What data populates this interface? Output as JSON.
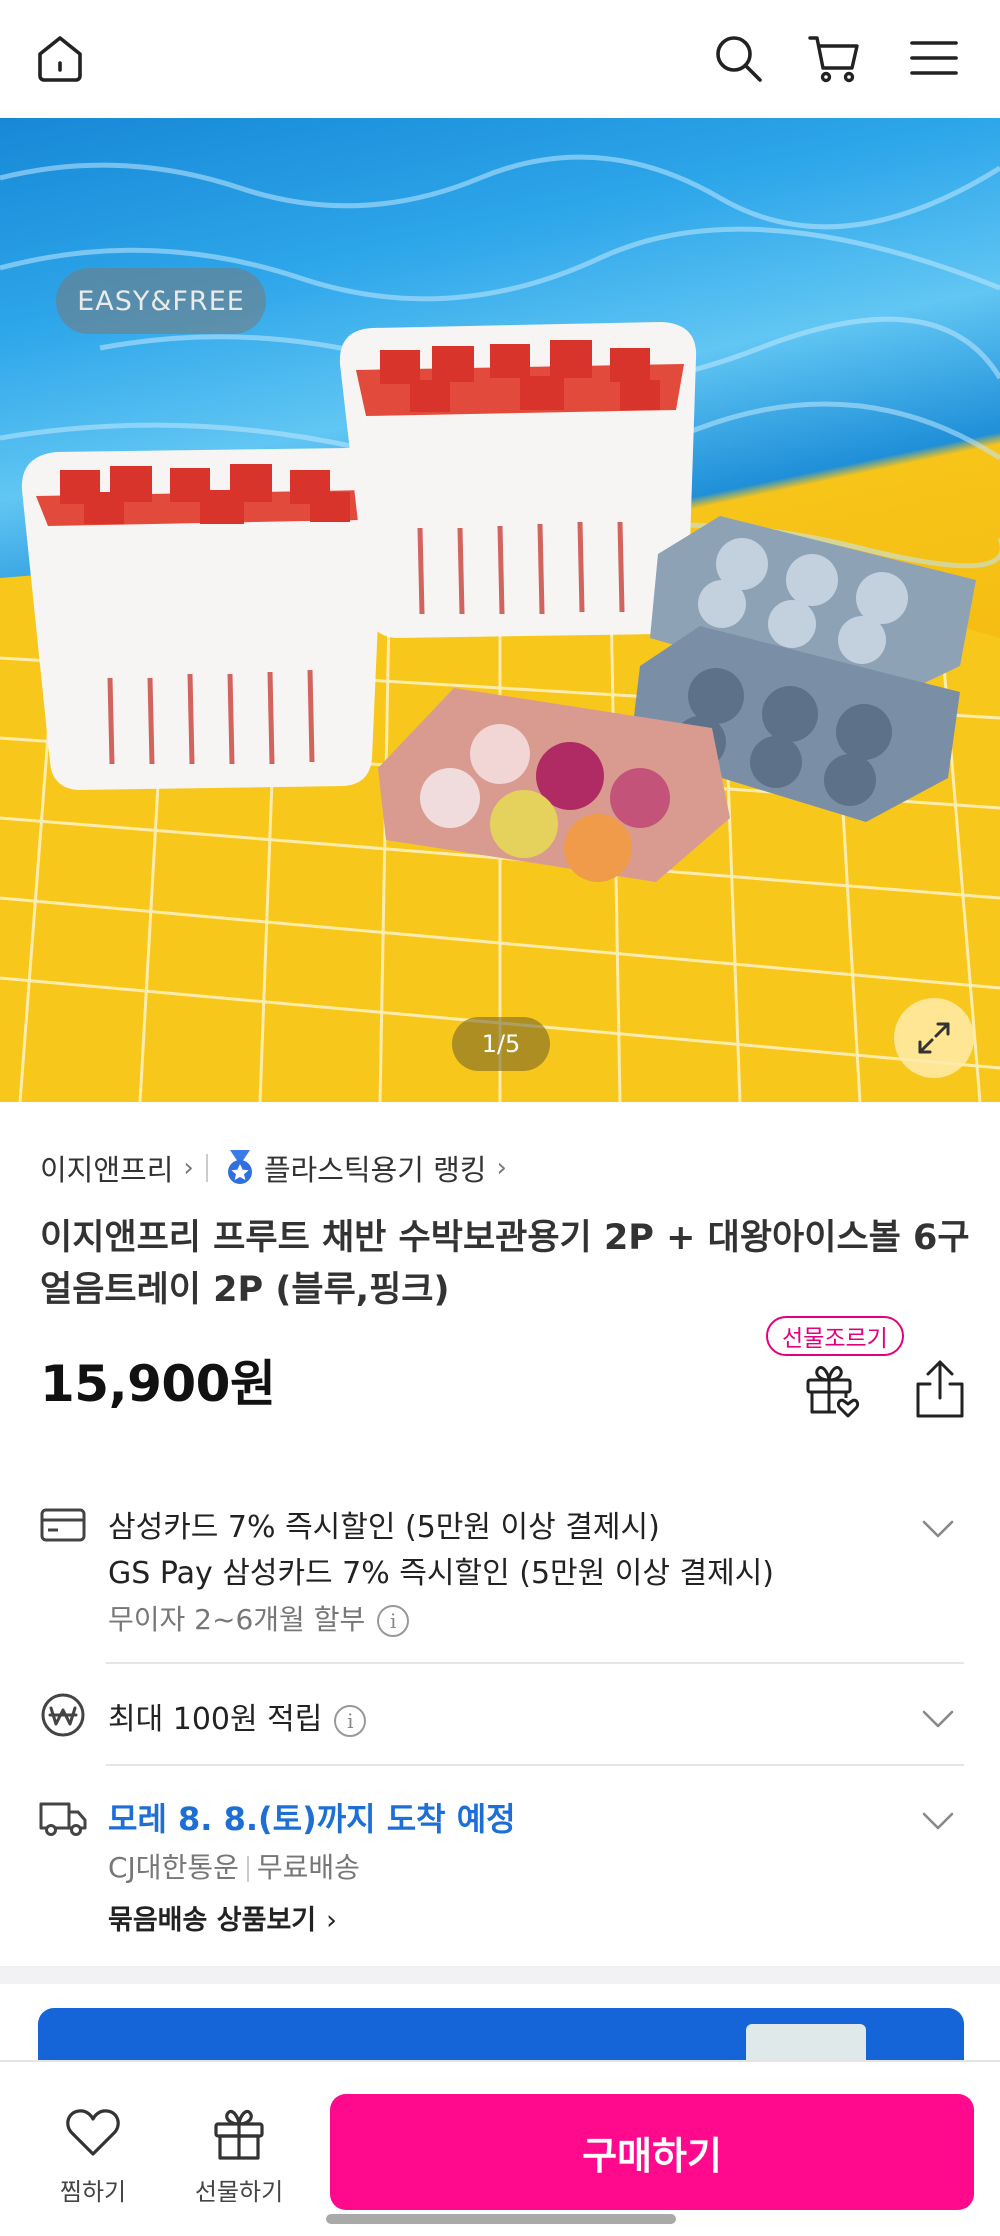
{
  "header": {
    "home_icon": "home-icon",
    "search_icon": "search-icon",
    "cart_icon": "cart-icon",
    "menu_icon": "hamburger-menu-icon"
  },
  "gallery": {
    "brand_watermark": "EASY&FREE",
    "counter": "1/5",
    "current_index": 1,
    "total": 5,
    "expand_icon": "expand-icon"
  },
  "product": {
    "brand": "이지앤프리",
    "ranking_label": "플라스틱용기 랭킹",
    "title_line1": "이지앤프리 프루트 채반 수박보관용기 2P + 대왕아이스볼 6구",
    "title_line2": "얼음트레이 2P (블루,핑크)",
    "price": "15,900원",
    "gift_tag": "선물조르기"
  },
  "benefits": {
    "card_line1": "삼성카드 7% 즉시할인 (5만원 이상 결제시)",
    "card_line2": "GS Pay 삼성카드 7% 즉시할인 (5만원 이상 결제시)",
    "installment": "무이자 2~6개월 할부",
    "points": "최대 100원 적립",
    "delivery_eta": "모레 8. 8.(토)까지 도착 예정",
    "courier": "CJ대한통운",
    "shipping_fee": "무료배송",
    "bundle_link": "묶음배송 상품보기"
  },
  "bottom_bar": {
    "wishlist_label": "찜하기",
    "gift_label": "선물하기",
    "buy_label": "구매하기"
  },
  "colors": {
    "accent_pink": "#ff0a8c",
    "delivery_blue": "#1d6fd6",
    "gift_tag": "#e3007f"
  }
}
